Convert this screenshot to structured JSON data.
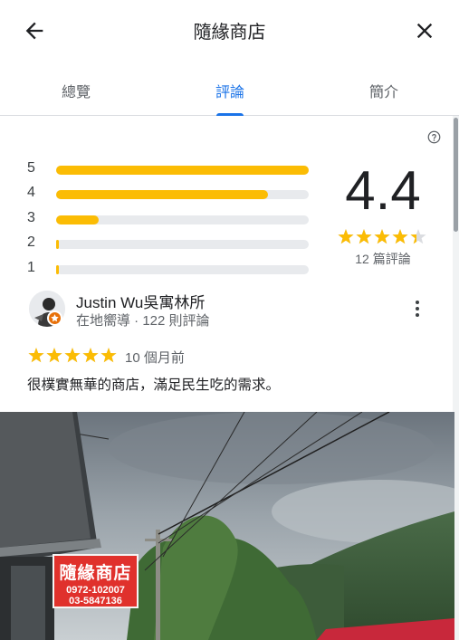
{
  "header": {
    "title": "隨緣商店",
    "back_icon": "arrow-back-icon",
    "close_icon": "close-icon"
  },
  "tabs": [
    {
      "label": "總覽",
      "active": false
    },
    {
      "label": "評論",
      "active": true
    },
    {
      "label": "簡介",
      "active": false
    }
  ],
  "summary": {
    "rating": "4.4",
    "stars": 4.4,
    "review_count": "12 篇評論",
    "distribution": [
      {
        "label": "5",
        "fraction": 1.0
      },
      {
        "label": "4",
        "fraction": 0.84
      },
      {
        "label": "3",
        "fraction": 0.17
      },
      {
        "label": "2",
        "fraction": 0.01
      },
      {
        "label": "1",
        "fraction": 0.01
      }
    ],
    "star_color": "#fbbc04"
  },
  "review": {
    "name": "Justin Wu吳寓林所",
    "meta": "在地嚮導 · 122 則評論",
    "stars": 5,
    "date": "10 個月前",
    "text": "很樸實無華的商店，滿足民生吃的需求。"
  },
  "photo": {
    "sign_title": "隨緣商店",
    "sign_phone_1": "0972-102007",
    "sign_phone_2": "03-5847136"
  },
  "colors": {
    "accent": "#1a73e8",
    "star": "#fbbc04"
  }
}
